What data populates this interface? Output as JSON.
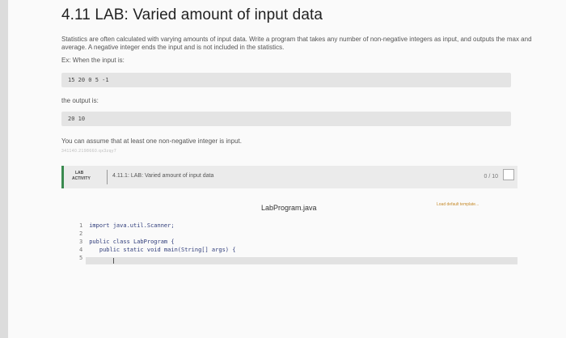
{
  "title": "4.11 LAB: Varied amount of input data",
  "description": "Statistics are often calculated with varying amounts of input data. Write a program that takes any number of non-negative integers as input, and outputs the max and average. A negative integer ends the input and is not included in the statistics.",
  "example_intro": "Ex: When the input is:",
  "example_input": "15 20 0 5 -1",
  "output_intro": "the output is:",
  "example_output": "20 10",
  "assumption": "You can assume that at least one non-negative integer is input.",
  "faint_id": "341140.2198660.qx3zqy7",
  "lab": {
    "tag_line1": "LAB",
    "tag_line2": "ACTIVITY",
    "name": "4.11.1: LAB: Varied amount of input data",
    "score": "0 / 10"
  },
  "file_name": "LabProgram.java",
  "load_template": "Load default template...",
  "code_lines": [
    {
      "num": "1",
      "text": "import java.util.Scanner;"
    },
    {
      "num": "2",
      "text": ""
    },
    {
      "num": "3",
      "text": "public class LabProgram {"
    },
    {
      "num": "4",
      "text": "   public static void main(String[] args) {"
    },
    {
      "num": "5",
      "text": ""
    }
  ],
  "colors": {
    "accent_green": "#3a8a4f",
    "load_link": "#c58a2a"
  }
}
